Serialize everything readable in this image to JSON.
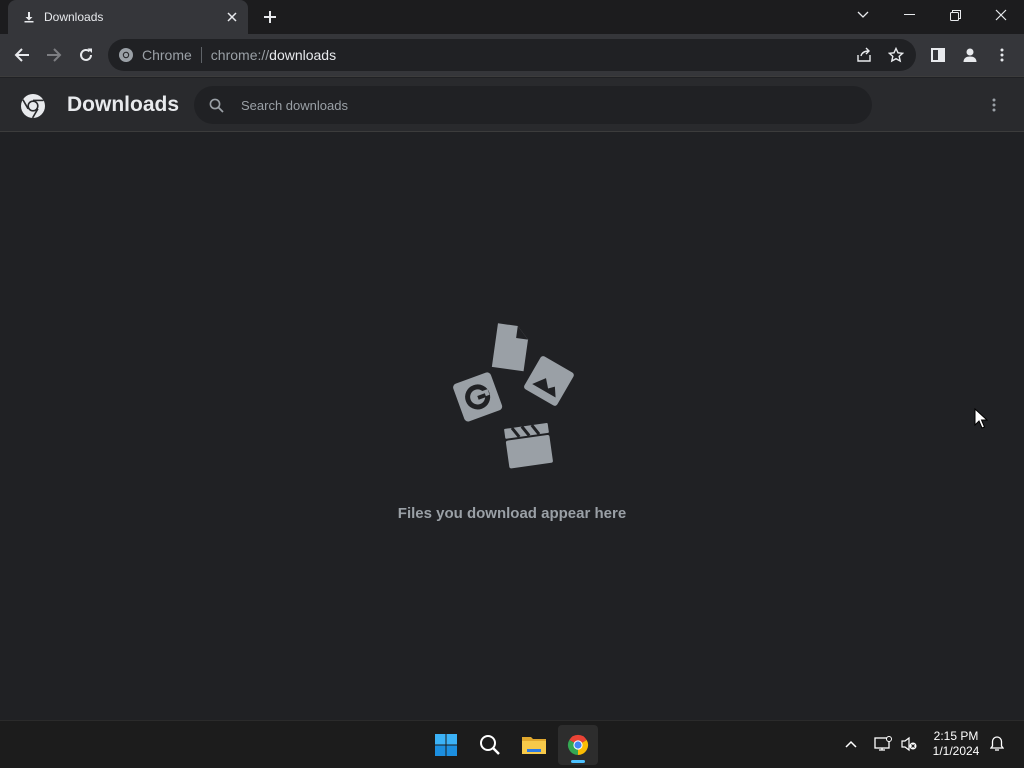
{
  "tab": {
    "title": "Downloads",
    "icon": "download-icon"
  },
  "window_controls": [
    "tab-search-icon",
    "minimize-icon",
    "restore-icon",
    "close-icon"
  ],
  "omnibox": {
    "site_label": "Chrome",
    "url_scheme": "chrome://",
    "url_host": "downloads"
  },
  "downloads": {
    "title": "Downloads",
    "search_placeholder": "Search downloads",
    "empty_message": "Files you download appear here"
  },
  "taskbar": {
    "apps": [
      "start-icon",
      "search-icon",
      "file-explorer-icon",
      "chrome-icon"
    ],
    "time": "2:15 PM",
    "date": "1/1/2024"
  },
  "colors": {
    "background": "#202124",
    "toolbar": "#35363a",
    "header": "#292a2d",
    "muted_text": "#9aa0a6",
    "illustration": "#9aa0a6",
    "accent": "#4cc2ff"
  }
}
